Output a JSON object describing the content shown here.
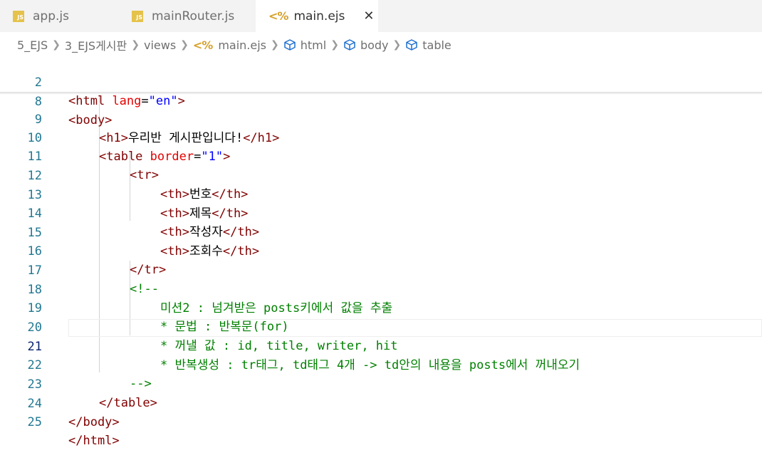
{
  "tabs": [
    {
      "label": "app.js",
      "icon": "js-file-icon",
      "active": false
    },
    {
      "label": "mainRouter.js",
      "icon": "js-file-icon",
      "active": false
    },
    {
      "label": "main.ejs",
      "icon": "ejs-file-icon",
      "active": true
    }
  ],
  "ejs_glyph": "<%",
  "js_glyph": "JS",
  "close_glyph": "✕",
  "breadcrumb": [
    "5_EJS",
    "3_EJS게시판",
    "views",
    "main.ejs",
    "html",
    "body",
    "table"
  ],
  "editor": {
    "current_line": "21",
    "lines": [
      {
        "n": "2",
        "segs": [
          "<html",
          " ",
          "lang",
          "=",
          "\"en\"",
          ">"
        ]
      },
      {
        "n": "8",
        "segs": [
          "<body>"
        ]
      },
      {
        "n": "9",
        "segs": [
          "<h1>",
          "우리반 게시판입니다!",
          "</h1>"
        ]
      },
      {
        "n": "10",
        "segs": [
          "<table",
          " ",
          "border",
          "=",
          "\"1\"",
          ">"
        ]
      },
      {
        "n": "11",
        "segs": [
          "<tr>"
        ]
      },
      {
        "n": "12",
        "segs": [
          "<th>",
          "번호",
          "</th>"
        ]
      },
      {
        "n": "13",
        "segs": [
          "<th>",
          "제목",
          "</th>"
        ]
      },
      {
        "n": "14",
        "segs": [
          "<th>",
          "작성자",
          "</th>"
        ]
      },
      {
        "n": "15",
        "segs": [
          "<th>",
          "조회수",
          "</th>"
        ]
      },
      {
        "n": "16",
        "segs": [
          "</tr>"
        ]
      },
      {
        "n": "17",
        "segs": [
          "<!--"
        ]
      },
      {
        "n": "18",
        "segs": [
          "미션2 : 넘겨받은 posts키에서 값을 추출"
        ]
      },
      {
        "n": "19",
        "segs": [
          "* 문법 : 반복문(for)"
        ]
      },
      {
        "n": "20",
        "segs": [
          "* 꺼낼 값 : id, title, writer, hit"
        ]
      },
      {
        "n": "21",
        "segs": [
          "* 반복생성 : tr태그, td태그 4개 -> td안의 내용을 posts에서 꺼내오기"
        ]
      },
      {
        "n": "22",
        "segs": [
          "-->"
        ]
      },
      {
        "n": "23",
        "segs": [
          "</table>"
        ]
      },
      {
        "n": "24",
        "segs": [
          "</body>"
        ]
      },
      {
        "n": "25",
        "segs": [
          "</html>"
        ]
      }
    ]
  }
}
